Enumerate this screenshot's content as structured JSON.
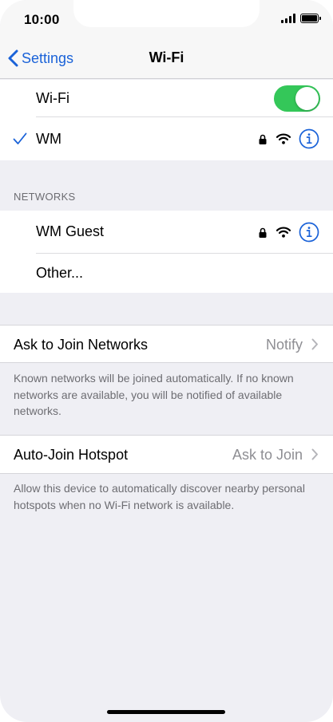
{
  "status_bar": {
    "time": "10:00",
    "icons": [
      "cellular-signal-icon",
      "battery-icon"
    ]
  },
  "nav": {
    "back_label": "Settings",
    "title": "Wi-Fi"
  },
  "wifi": {
    "label": "Wi-Fi",
    "enabled": true,
    "toggle_color": "#34c759"
  },
  "connected_network": {
    "name": "WM",
    "checked": true,
    "secured": true
  },
  "networks": {
    "header": "NETWORKS",
    "items": [
      {
        "name": "WM Guest",
        "secured": true
      },
      {
        "name": "Other..."
      }
    ]
  },
  "ask_to_join": {
    "label": "Ask to Join Networks",
    "value": "Notify",
    "footnote": "Known networks will be joined automatically. If no known networks are available, you will be notified of available networks."
  },
  "auto_join_hotspot": {
    "label": "Auto-Join Hotspot",
    "value": "Ask to Join",
    "footnote": "Allow this device to automatically discover nearby personal hotspots when no Wi-Fi network is available."
  },
  "colors": {
    "accent": "#1a62d8",
    "background": "#efeff4",
    "secondary_text": "#8e8e93"
  }
}
